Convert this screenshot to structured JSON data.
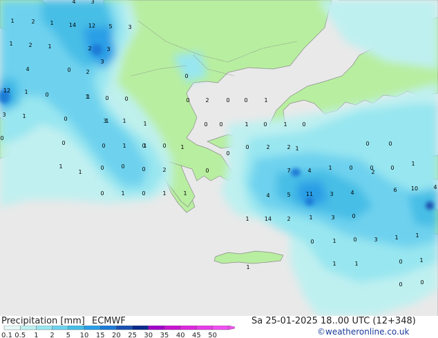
{
  "legend": {
    "title": "Precipitation [mm]",
    "model": "ECMWF",
    "timestamp": "Sa 25-01-2025 18..00 UTC (12+348)",
    "credit": "©weatheronline.co.uk",
    "ticks": [
      "0.1",
      "0.5",
      "1",
      "2",
      "5",
      "10",
      "15",
      "20",
      "25",
      "30",
      "35",
      "40",
      "45",
      "50"
    ],
    "colors": [
      "#e6fafa",
      "#bff0f0",
      "#98e6f0",
      "#6ed2ee",
      "#46bee6",
      "#2a9ee6",
      "#1f7bd6",
      "#1a52b0",
      "#0a2a8a",
      "#a000c8",
      "#c814d2",
      "#dc28dc",
      "#e63ce6",
      "#f050f0"
    ]
  },
  "map_labels": [
    {
      "t": "1"
    },
    {
      "t": "2"
    },
    {
      "t": "1"
    },
    {
      "t": "14"
    },
    {
      "t": "12"
    },
    {
      "t": "5"
    },
    {
      "t": "3"
    },
    {
      "t": "4"
    },
    {
      "t": "3"
    },
    {
      "t": "1"
    },
    {
      "t": "2"
    },
    {
      "t": "1"
    },
    {
      "t": "2"
    },
    {
      "t": "3"
    },
    {
      "t": "3"
    },
    {
      "t": "4"
    },
    {
      "t": "0"
    },
    {
      "t": "2"
    },
    {
      "t": "12"
    },
    {
      "t": "1"
    },
    {
      "t": "3"
    },
    {
      "t": "1"
    },
    {
      "t": "0"
    },
    {
      "t": "1"
    },
    {
      "t": "0"
    },
    {
      "t": "3"
    },
    {
      "t": "1"
    },
    {
      "t": "0"
    },
    {
      "t": "1"
    },
    {
      "t": "0"
    },
    {
      "t": "0"
    },
    {
      "t": "2"
    },
    {
      "t": "0"
    },
    {
      "t": "0"
    },
    {
      "t": "1"
    },
    {
      "t": "0"
    },
    {
      "t": "0"
    },
    {
      "t": "0"
    },
    {
      "t": "1"
    },
    {
      "t": "0"
    },
    {
      "t": "1"
    },
    {
      "t": "0"
    },
    {
      "t": "1"
    },
    {
      "t": "1"
    },
    {
      "t": "0"
    },
    {
      "t": "0"
    },
    {
      "t": "0"
    },
    {
      "t": "0"
    },
    {
      "t": "1"
    },
    {
      "t": "0"
    },
    {
      "t": "2"
    },
    {
      "t": "2"
    },
    {
      "t": "0"
    },
    {
      "t": "7"
    },
    {
      "t": "4"
    },
    {
      "t": "1"
    },
    {
      "t": "0"
    },
    {
      "t": "0"
    },
    {
      "t": "0"
    },
    {
      "t": "1"
    },
    {
      "t": "0"
    },
    {
      "t": "4"
    },
    {
      "t": "5"
    },
    {
      "t": "11"
    },
    {
      "t": "3"
    },
    {
      "t": "4"
    },
    {
      "t": "2"
    },
    {
      "t": "6"
    },
    {
      "t": "10"
    },
    {
      "t": "4"
    },
    {
      "t": "1"
    },
    {
      "t": "14"
    },
    {
      "t": "2"
    },
    {
      "t": "1"
    },
    {
      "t": "3"
    },
    {
      "t": "0"
    },
    {
      "t": "1"
    },
    {
      "t": "0"
    },
    {
      "t": "3"
    },
    {
      "t": "1"
    },
    {
      "t": "1"
    },
    {
      "t": "1"
    },
    {
      "t": "1"
    },
    {
      "t": "0"
    },
    {
      "t": "0"
    },
    {
      "t": "0"
    },
    {
      "t": "2"
    },
    {
      "t": "1"
    },
    {
      "t": "0"
    },
    {
      "t": "1"
    },
    {
      "t": "0"
    },
    {
      "t": "1"
    },
    {
      "t": "0"
    },
    {
      "t": "1"
    },
    {
      "t": "1"
    },
    {
      "t": "0"
    },
    {
      "t": "1"
    },
    {
      "t": "1"
    },
    {
      "t": "0"
    },
    {
      "t": "1"
    },
    {
      "t": "0"
    },
    {
      "t": "0"
    },
    {
      "t": "1"
    },
    {
      "t": "1"
    },
    {
      "t": "0"
    },
    {
      "t": "0"
    }
  ]
}
